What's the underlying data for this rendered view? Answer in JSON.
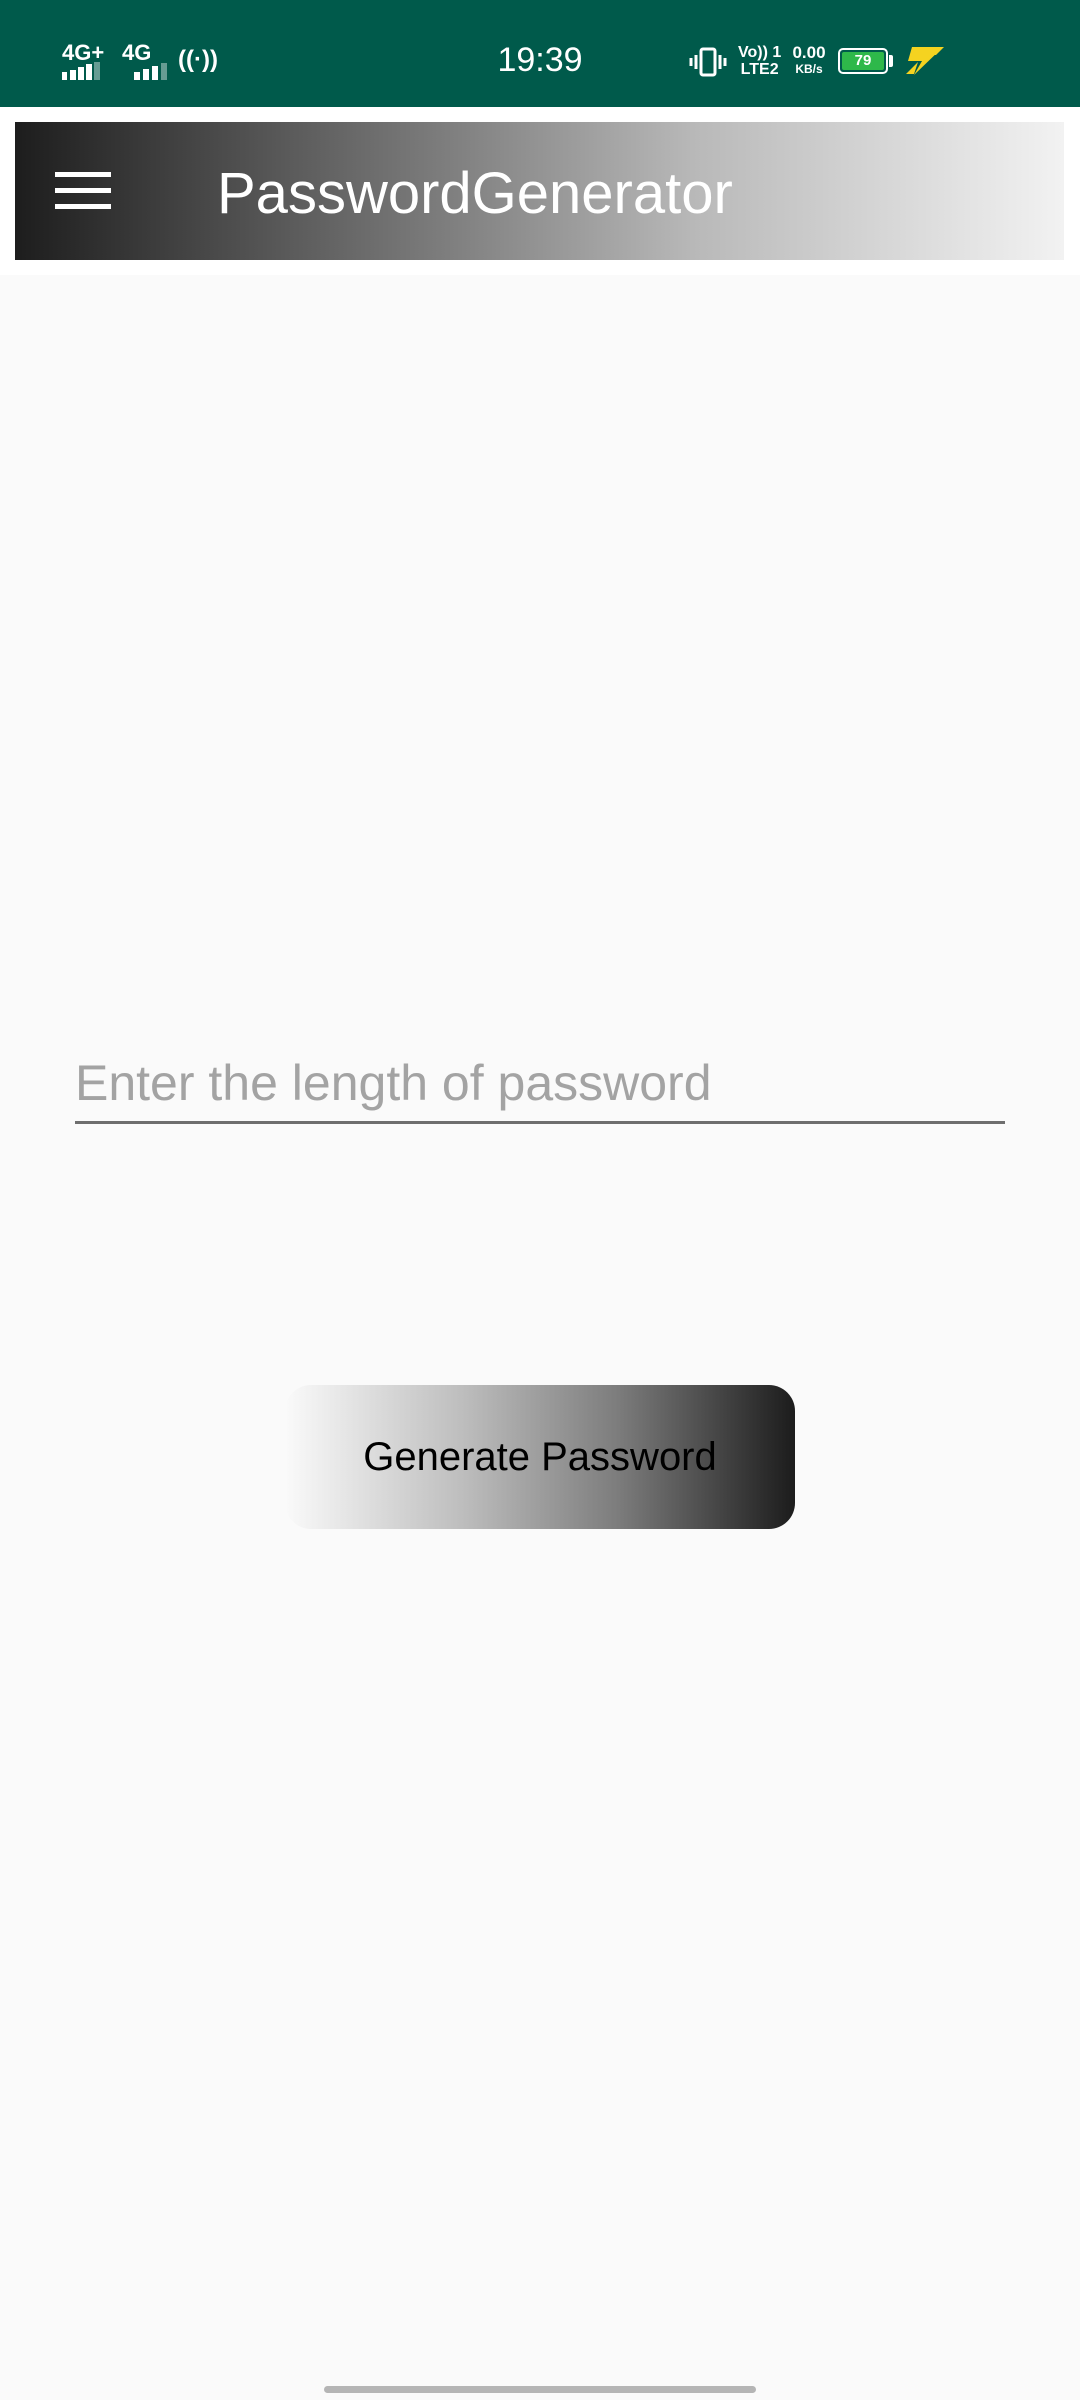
{
  "status_bar": {
    "net1": "4G+",
    "net2": "4G",
    "time": "19:39",
    "volte_line1": "Vo)) 1",
    "volte_line2": "LTE2",
    "speed_value": "0.00",
    "speed_unit": "KB/s",
    "battery_level": "79",
    "colors": {
      "background": "#005a4b",
      "battery_fill": "#2eb84a",
      "charge_bolt": "#f5d320"
    }
  },
  "app_bar": {
    "title": "PasswordGenerator",
    "menu_icon": "hamburger-menu-icon"
  },
  "form": {
    "length_placeholder": "Enter the length of password",
    "length_value": "",
    "generate_label": "Generate Password"
  }
}
